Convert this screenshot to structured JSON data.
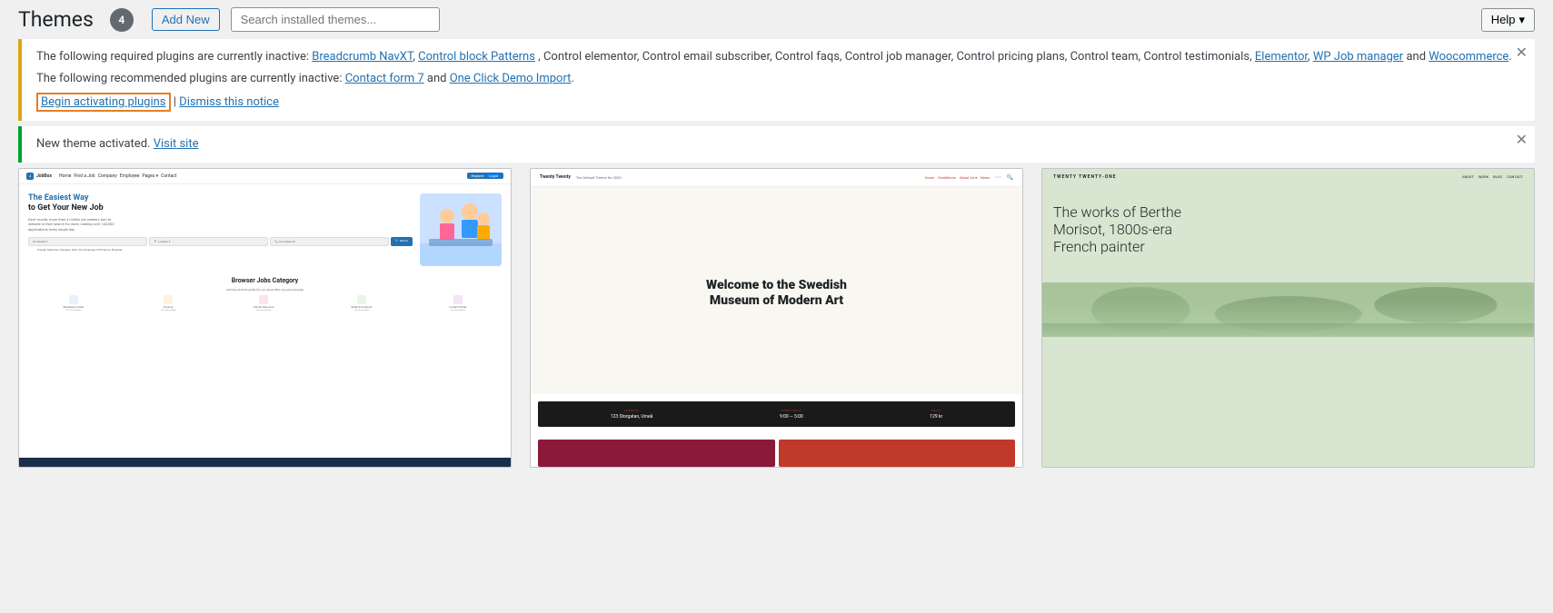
{
  "header": {
    "title": "Themes",
    "count": "4",
    "add_new_label": "Add New",
    "search_placeholder": "Search installed themes...",
    "help_label": "Help"
  },
  "notice_plugins": {
    "text_required_prefix": "The following required plugins are currently inactive: ",
    "required_plugins_links": [
      "Breadcrumb NavXT",
      "Control block Patterns"
    ],
    "required_plugins_plain": ", Control elementor, Control email subscriber, Control faqs, Control job manager, Control pricing plans, Control team, Control testimonials, ",
    "elementor_link": "Elementor",
    "wp_job_link": "WP Job manager",
    "and_woocommerce": " and ",
    "woocommerce_link": "Woocommerce",
    "text_recommended_prefix": "The following recommended plugins are currently inactive: ",
    "contact_form_link": "Contact form 7",
    "and_text": " and ",
    "one_click_link": "One Click Demo Import",
    "begin_link": "Begin activating plugins",
    "separator": " | ",
    "dismiss_link": "Dismiss this notice"
  },
  "notice_activated": {
    "text": "New theme activated. ",
    "visit_link": "Visit site"
  },
  "themes": [
    {
      "name": "JobBox",
      "type": "jobbox",
      "nav_links": [
        "Home",
        "Find a Job",
        "Company",
        "Employee",
        "Pages",
        "Contact"
      ],
      "register_label": "Register",
      "hero_title_part1": "The Easiest Way",
      "hero_title_part2": "to Get Your New Job",
      "hero_subtitle": "Each month, more than 3 million job seekers turn to website in their search for work, making over 140,000 applications every single day",
      "search_fields": [
        "Industry",
        "Location",
        "Your keyword"
      ],
      "search_btn": "Search",
      "popular_label": "Popular Searches:",
      "popular_items": "Designer, Web, iOS, Developer, PHP, Senior, Engineer",
      "section_title": "Browser Jobs Category",
      "section_subtitle": "Find the job that's perfect for you about 800+ new jobs everyday",
      "categories": [
        {
          "label": "Marketing & Sale"
        },
        {
          "label": "Finance"
        },
        {
          "label": "Human Resource"
        },
        {
          "label": "Retail & Products"
        },
        {
          "label": "Content Writer"
        }
      ]
    },
    {
      "name": "Twenty Twenty",
      "type": "twentytwenty",
      "tagline": "The Default Theme for 2020",
      "nav_links": [
        "Home",
        "Exhibitions",
        "About Us",
        "News"
      ],
      "hero_title": "Welcome to the Swedish Museum of Modern Art",
      "info_columns": [
        {
          "label": "ADDRESS",
          "value": "123 Storgatan, Umeå"
        },
        {
          "label": "OPEN TODAY",
          "value": "9:00 — 5:00"
        },
        {
          "label": "PRICE",
          "value": "129 kr"
        }
      ]
    },
    {
      "name": "Twenty Twenty-One",
      "type": "twentytwentyone",
      "site_title": "TWENTY TWENTY-ONE",
      "nav_links": [
        "ABOUT",
        "WORK",
        "BLOG",
        "CONTACT"
      ],
      "hero_title": "The works of Berthe Morisot, 1800s-era French painter"
    }
  ],
  "colors": {
    "wp_blue": "#2271b1",
    "notice_warning_border": "#dba617",
    "notice_success_border": "#00a32a",
    "badge_bg": "#646970",
    "twentytwenty_red": "#c0392b",
    "tto_bg": "#d8e5d0"
  }
}
